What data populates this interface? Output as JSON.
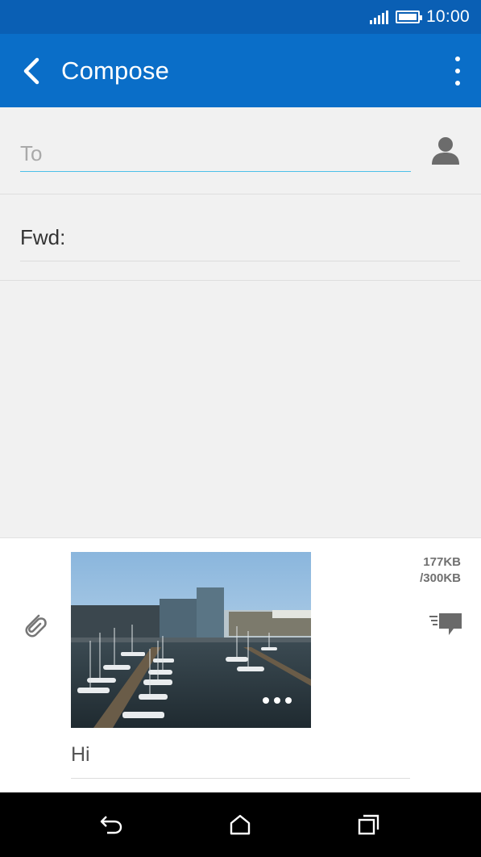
{
  "status_bar": {
    "time": "10:00",
    "battery_fill": 1.0,
    "signal_bars": 5
  },
  "app_bar": {
    "title": "Compose",
    "back_icon": "chevron-left-icon",
    "overflow_icon": "more-vert-icon"
  },
  "compose": {
    "to_placeholder": "To",
    "to_value": "",
    "contact_icon": "person-icon",
    "subject_label": "Fwd:"
  },
  "message": {
    "attach_icon": "paperclip-icon",
    "size_used": "177KB",
    "size_limit": "/300KB",
    "template_icon": "quick-text-icon",
    "body_text": "Hi",
    "photo_more_icon": "more-horiz-icon"
  },
  "nav_bar": {
    "back_icon": "back-icon",
    "home_icon": "home-icon",
    "recent_icon": "recent-apps-icon"
  },
  "colors": {
    "status_bar": "#0a5fb4",
    "app_bar": "#0a6ec8",
    "input_underline": "#4cc0e8",
    "background": "#f1f1f1"
  }
}
